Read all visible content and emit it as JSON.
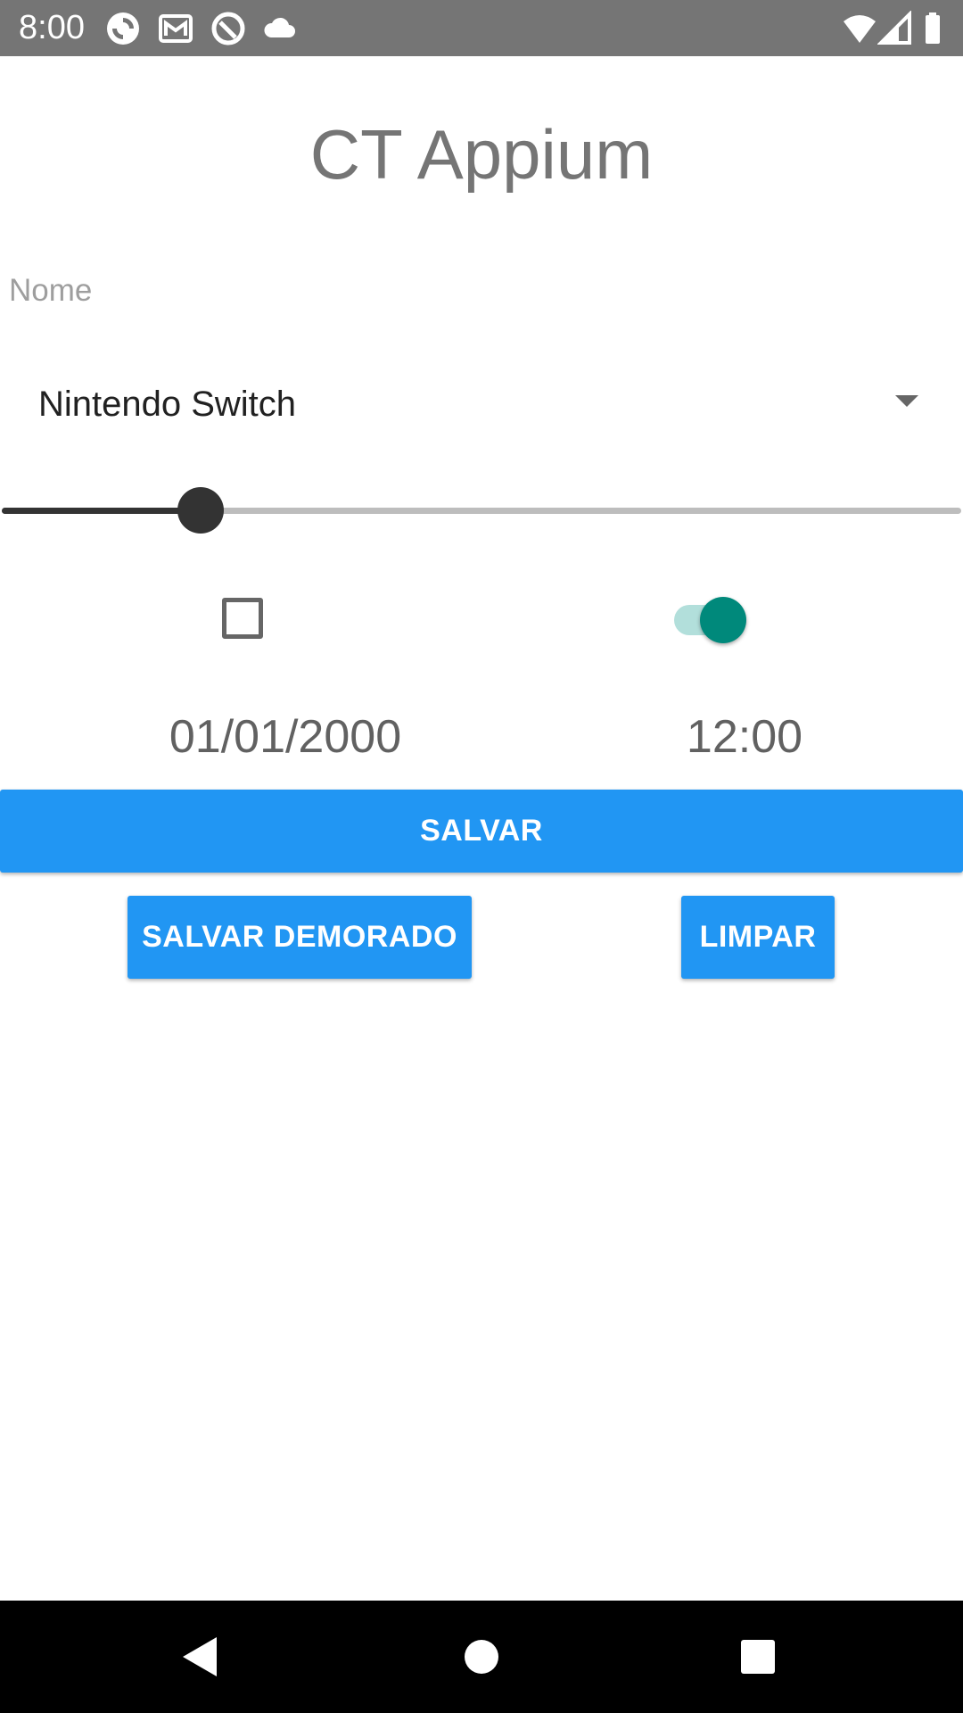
{
  "status_bar": {
    "time": "8:00",
    "left_icons": [
      "sync-icon",
      "gallery-icon",
      "vpn-icon",
      "cloud-icon"
    ],
    "right_icons": [
      "wifi-icon",
      "cell-signal-icon",
      "battery-icon"
    ]
  },
  "app": {
    "title": "CT Appium"
  },
  "form": {
    "name_placeholder": "Nome",
    "name_value": "",
    "console_selected": "Nintendo Switch",
    "slider_fraction": 0.25,
    "checkbox_checked": false,
    "switch_on": true,
    "date": "01/01/2000",
    "time": "12:00"
  },
  "buttons": {
    "save": "SALVAR",
    "save_delayed": "SALVAR DEMORADO",
    "clear": "LIMPAR"
  },
  "navigation": {
    "icons": [
      "back-icon",
      "home-icon",
      "recents-icon"
    ]
  },
  "colors": {
    "status_bar": "#757575",
    "accent_button": "#2196f3",
    "switch_thumb": "#00897b",
    "switch_track": "#b2dfdb",
    "title_text": "#757575"
  }
}
